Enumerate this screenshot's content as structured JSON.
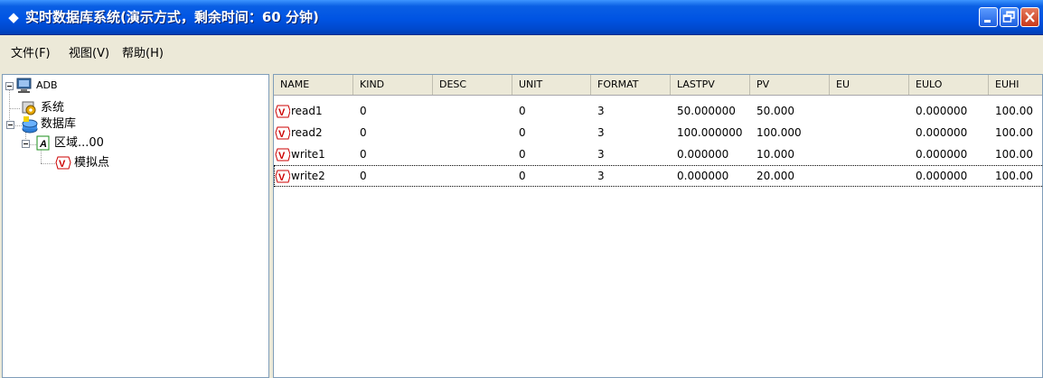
{
  "window": {
    "title": "实时数据库系统(演示方式，剩余时间：60 分钟)",
    "icon": "diamond-icon",
    "controls": [
      "minimize-icon",
      "restore-icon",
      "close-icon"
    ]
  },
  "menu": [
    {
      "label": "文件(F)"
    },
    {
      "label": "视图(V)"
    },
    {
      "label": "帮助(H)"
    }
  ],
  "tree": {
    "root": {
      "label": "ADB",
      "icon": "computer-icon"
    },
    "system": {
      "label": "系统",
      "icon": "gear-icon"
    },
    "database": {
      "label": "数据库",
      "icon": "database-icon"
    },
    "area": {
      "label": "区域...00",
      "icon": "area-icon"
    },
    "analog": {
      "label": "模拟点",
      "icon": "analog-point-icon"
    }
  },
  "table": {
    "columns": [
      "NAME",
      "KIND",
      "DESC",
      "UNIT",
      "FORMAT",
      "LASTPV",
      "PV",
      "EU",
      "EULO",
      "EUHI"
    ],
    "rows": [
      {
        "name": "read1",
        "kind": "0",
        "desc": "",
        "unit": "0",
        "format": "3",
        "lastpv": "50.000000",
        "pv": "50.000",
        "eu": "",
        "eulo": "0.000000",
        "euhi": "100.00"
      },
      {
        "name": "read2",
        "kind": "0",
        "desc": "",
        "unit": "0",
        "format": "3",
        "lastpv": "100.000000",
        "pv": "100.000",
        "eu": "",
        "eulo": "0.000000",
        "euhi": "100.00"
      },
      {
        "name": "write1",
        "kind": "0",
        "desc": "",
        "unit": "0",
        "format": "3",
        "lastpv": "0.000000",
        "pv": "10.000",
        "eu": "",
        "eulo": "0.000000",
        "euhi": "100.00"
      },
      {
        "name": "write2",
        "kind": "0",
        "desc": "",
        "unit": "0",
        "format": "3",
        "lastpv": "0.000000",
        "pv": "20.000",
        "eu": "",
        "eulo": "0.000000",
        "euhi": "100.00"
      }
    ],
    "row_icon": "analog-point-icon",
    "focused_row": 3
  },
  "colors": {
    "titlebar": "#0054E3",
    "window_bg": "#ECE9D8",
    "pane_bg": "#FFFFFF",
    "close_button": "#C8391A",
    "analog_icon": "#CC0000"
  }
}
